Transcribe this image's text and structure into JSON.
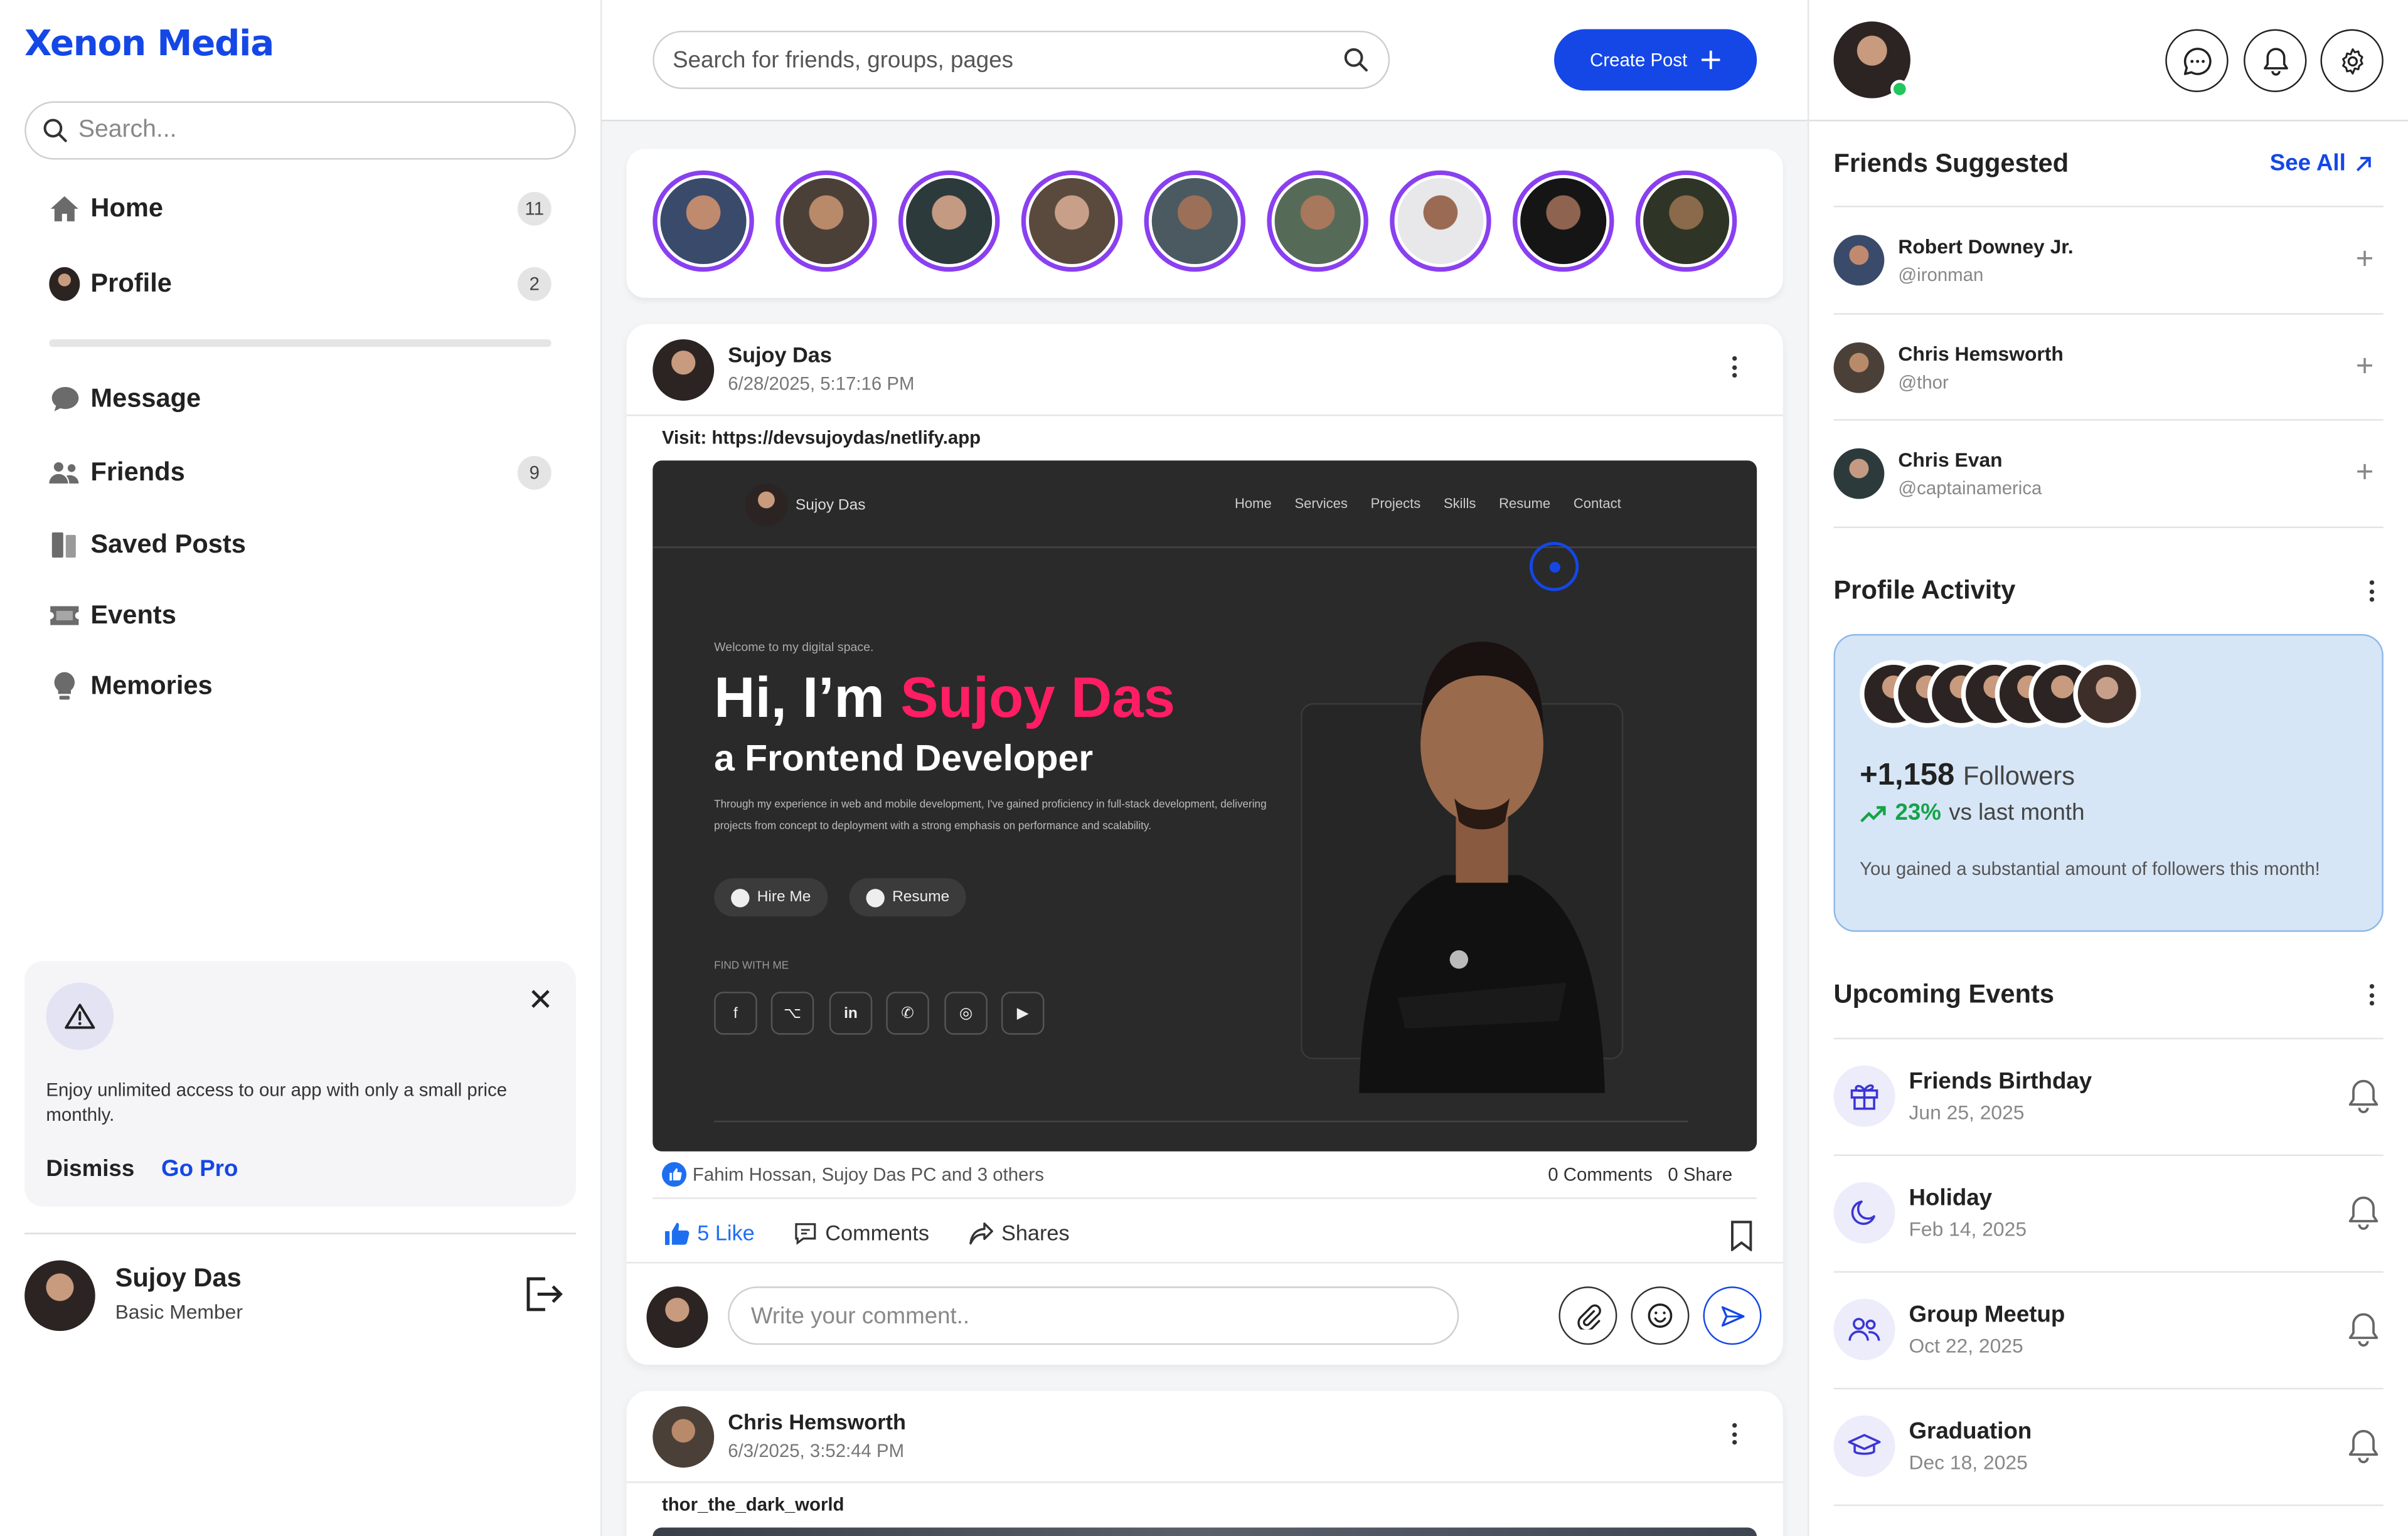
{
  "app": {
    "name": "Xenon Media"
  },
  "left": {
    "search_placeholder": "Search...",
    "nav": [
      {
        "label": "Home",
        "badge": "11",
        "icon": "home-icon"
      },
      {
        "label": "Profile",
        "badge": "2",
        "icon": "profile-avatar"
      },
      {
        "label": "Message",
        "badge": "",
        "icon": "chat-bubble-icon"
      },
      {
        "label": "Friends",
        "badge": "9",
        "icon": "friends-icon"
      },
      {
        "label": "Saved Posts",
        "badge": "",
        "icon": "bookmark-book-icon"
      },
      {
        "label": "Events",
        "badge": "",
        "icon": "ticket-icon"
      },
      {
        "label": "Memories",
        "badge": "",
        "icon": "lightbulb-icon"
      }
    ],
    "promo": {
      "text": "Enjoy unlimited access to our app with only a small price monthly.",
      "dismiss": "Dismiss",
      "go_pro": "Go Pro"
    },
    "user": {
      "name": "Sujoy Das",
      "role": "Basic Member"
    }
  },
  "topbar": {
    "search_placeholder": "Search for friends, groups, pages",
    "create_post": "Create Post"
  },
  "stories": {
    "count": 9,
    "ring_color": "#8a3ff0"
  },
  "posts": [
    {
      "author": "Sujoy Das",
      "date": "6/28/2025, 5:17:16 PM",
      "text": "Visit: https://devsujoydas/netlify.app",
      "preview": {
        "brand": "Sujoy Das",
        "menu": [
          "Home",
          "Services",
          "Projects",
          "Skills",
          "Resume",
          "Contact"
        ],
        "welcome": "Welcome to my digital space.",
        "hi": "Hi, I’m ",
        "name": "Sujoy Das",
        "role": "a Frontend Developer",
        "desc": "Through my experience in web and mobile development, I've gained proficiency in full-stack development, delivering projects from concept to deployment with a strong emphasis on performance and scalability.",
        "hire": "Hire Me",
        "resume": "Resume",
        "find": "FIND WITH ME",
        "socials": [
          "facebook-icon",
          "github-icon",
          "linkedin-icon",
          "whatsapp-icon",
          "instagram-icon",
          "youtube-icon"
        ]
      },
      "likes_text": "Fahim Hossan, Sujoy Das PC and 3 others",
      "comments_count": "0 Comments",
      "share_count": "0 Share",
      "like_label": "5 Like",
      "comments_label": "Comments",
      "shares_label": "Shares",
      "comment_placeholder": "Write your comment.."
    },
    {
      "author": "Chris Hemsworth",
      "date": "6/3/2025, 3:52:44 PM",
      "text": "thor_the_dark_world"
    }
  ],
  "right": {
    "friends_title": "Friends Suggested",
    "see_all": "See All",
    "friends": [
      {
        "name": "Robert Downey Jr.",
        "handle": "@ironman"
      },
      {
        "name": "Chris Hemsworth",
        "handle": "@thor"
      },
      {
        "name": "Chris Evan",
        "handle": "@captainamerica"
      }
    ],
    "activity_title": "Profile Activity",
    "followers": "+1,158",
    "followers_label": "Followers",
    "growth": "23%",
    "growth_label": "vs last month",
    "activity_msg": "You gained a substantial amount of followers this month!",
    "events_title": "Upcoming Events",
    "events": [
      {
        "name": "Friends Birthday",
        "date": "Jun 25, 2025",
        "icon": "gift-icon"
      },
      {
        "name": "Holiday",
        "date": "Feb 14, 2025",
        "icon": "moon-icon"
      },
      {
        "name": "Group Meetup",
        "date": "Oct 22, 2025",
        "icon": "group-icon"
      },
      {
        "name": "Graduation",
        "date": "Dec 18, 2025",
        "icon": "graduation-cap-icon"
      }
    ]
  },
  "colors": {
    "accent": "#1447e6",
    "highlight": "#ff1e64",
    "online": "#22c55e",
    "growth": "#16a34a"
  }
}
